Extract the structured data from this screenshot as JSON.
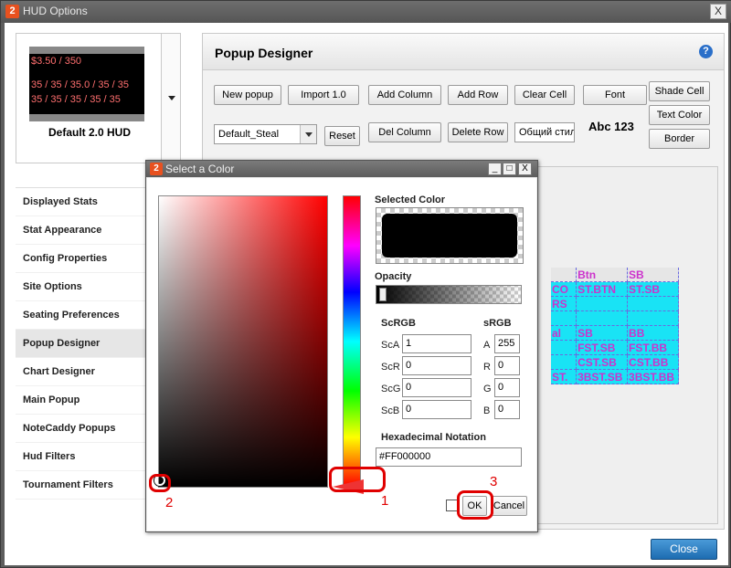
{
  "window": {
    "title": "HUD Options",
    "badge": "2",
    "close_glyph": "X"
  },
  "hud": {
    "name": "Default 2.0 HUD",
    "preview_lines": [
      {
        "text": "$3.50 / 350",
        "color": "#ff6f6f"
      },
      {
        "text": "35 / 35 / 35.0 / 35 / 35",
        "color": "#ff6f6f"
      },
      {
        "text": "35 / 35 / 35 / 35 / 35",
        "color": "#ff6f6f"
      }
    ]
  },
  "nav": {
    "items": [
      "Displayed Stats",
      "Stat Appearance",
      "Config Properties",
      "Site Options",
      "Seating Preferences",
      "Popup Designer",
      "Chart Designer",
      "Main Popup",
      "NoteCaddy Popups",
      "Hud Filters",
      "Tournament Filters"
    ],
    "active": "Popup Designer"
  },
  "designer": {
    "title": "Popup Designer",
    "help_glyph": "?",
    "buttons": {
      "new_popup": "New popup",
      "import": "Import 1.0",
      "add_column": "Add Column",
      "add_row": "Add Row",
      "clear_cell": "Clear Cell",
      "font": "Font",
      "shade_cell": "Shade Cell",
      "text_color": "Text Color",
      "border": "Border",
      "reset": "Reset",
      "del_column": "Del Column",
      "delete_row": "Delete Row"
    },
    "popup_select": "Default_Steal",
    "style_field": "Общий стиль",
    "font_preview": "Abc 123",
    "grid": [
      [
        "",
        "Btn",
        "SB"
      ],
      [
        "CO",
        "ST.BTN",
        "ST.SB"
      ],
      [
        "RS",
        "",
        ""
      ],
      [
        "",
        "",
        ""
      ],
      [
        "al",
        "SB",
        "BB"
      ],
      [
        "",
        "FST.SB",
        "FST.BB"
      ],
      [
        "",
        "CST.SB",
        "CST.BB"
      ],
      [
        "ST.",
        "3BST.SB",
        "3BST.BB"
      ]
    ]
  },
  "close_button": "Close",
  "dialog": {
    "title": "Select a Color",
    "badge": "2",
    "window_buttons": [
      "_",
      "□",
      "X"
    ],
    "selected_color_label": "Selected Color",
    "opacity_label": "Opacity",
    "scrgb_label": "ScRGB",
    "srgb_label": "sRGB",
    "scrgb": [
      {
        "label": "ScA",
        "value": "1"
      },
      {
        "label": "ScR",
        "value": "0"
      },
      {
        "label": "ScG",
        "value": "0"
      },
      {
        "label": "ScB",
        "value": "0"
      }
    ],
    "srgb": [
      {
        "label": "A",
        "value": "255"
      },
      {
        "label": "R",
        "value": "0"
      },
      {
        "label": "G",
        "value": "0"
      },
      {
        "label": "B",
        "value": "0"
      }
    ],
    "hex_label": "Hexadecimal Notation",
    "hex_value": "#FF000000",
    "ok": "OK",
    "cancel": "Cancel",
    "selected_color": "#000000",
    "opacity": 1.0
  },
  "annotations": {
    "one": "1",
    "two": "2",
    "three": "3",
    "color": "#e00000"
  }
}
